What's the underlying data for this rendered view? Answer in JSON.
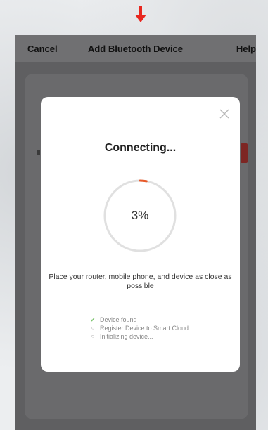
{
  "navbar": {
    "cancel_label": "Cancel",
    "title": "Add Bluetooth Device",
    "help_label": "Help"
  },
  "modal": {
    "title": "Connecting...",
    "progress_label": "3%",
    "progress_fraction": 0.03,
    "hint": "Place your router, mobile phone, and device as close as possible",
    "steps": [
      {
        "label": "Device found",
        "status": "done"
      },
      {
        "label": "Register Device to Smart Cloud",
        "status": "pending"
      },
      {
        "label": "Initializing device...",
        "status": "pending"
      }
    ]
  },
  "colors": {
    "accent": "#e85a2a",
    "arrow": "#e8271f",
    "check": "#7cc46e",
    "ring_track": "#e0e0e0",
    "overlay": "#5f5f61"
  },
  "icons": {
    "annotation": "down-arrow-icon",
    "close": "close-icon",
    "done": "checkmark-icon",
    "pending": "bullet-dot-icon"
  }
}
